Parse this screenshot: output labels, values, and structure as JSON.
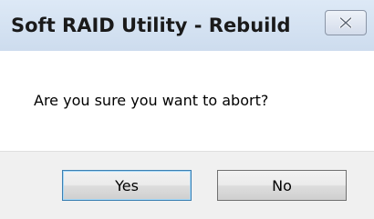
{
  "dialog": {
    "title": "Soft RAID Utility - Rebuild",
    "message": "Are you sure you want to abort?",
    "close_icon": "close-icon",
    "buttons": {
      "yes_label": "Yes",
      "no_label": "No"
    }
  },
  "colors": {
    "titlebar": "#cddcee",
    "content_background": "#ffffff",
    "button_bar_background": "#f0f0f0",
    "default_button_border": "#3c7fb1"
  }
}
